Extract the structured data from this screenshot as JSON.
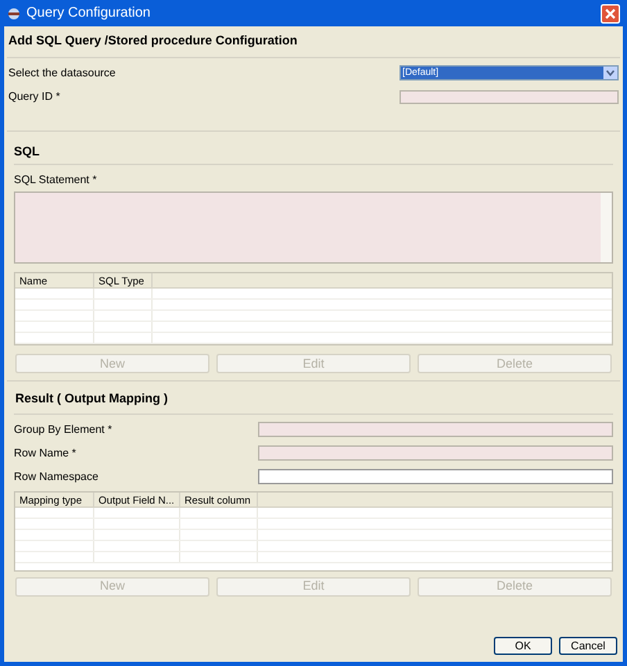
{
  "window": {
    "title": "Query Configuration"
  },
  "header": "Add SQL Query /Stored procedure Configuration",
  "datasource": {
    "label": "Select the datasource",
    "value": "[Default]"
  },
  "query_id": {
    "label": "Query ID *",
    "required": true
  },
  "sql": {
    "heading": "SQL",
    "statement_label": "SQL Statement *",
    "statement_required": true,
    "table": {
      "columns": [
        "Name",
        "SQL Type"
      ]
    },
    "buttons": [
      {
        "label": "New",
        "disabled": true
      },
      {
        "label": "Edit",
        "disabled": true
      },
      {
        "label": "Delete",
        "disabled": true
      }
    ]
  },
  "result": {
    "heading": "Result ( Output Mapping )",
    "fields": [
      {
        "label": "Group By Element *",
        "required": true
      },
      {
        "label": "Row Name *",
        "required": true
      },
      {
        "label": "Row Namespace",
        "required": false
      }
    ],
    "table": {
      "columns": [
        "Mapping type",
        "Output Field N...",
        "Result column"
      ]
    },
    "buttons": [
      {
        "label": "New",
        "disabled": true
      },
      {
        "label": "Edit",
        "disabled": true
      },
      {
        "label": "Delete",
        "disabled": true
      }
    ]
  },
  "footer_buttons": [
    "OK",
    "Cancel"
  ]
}
